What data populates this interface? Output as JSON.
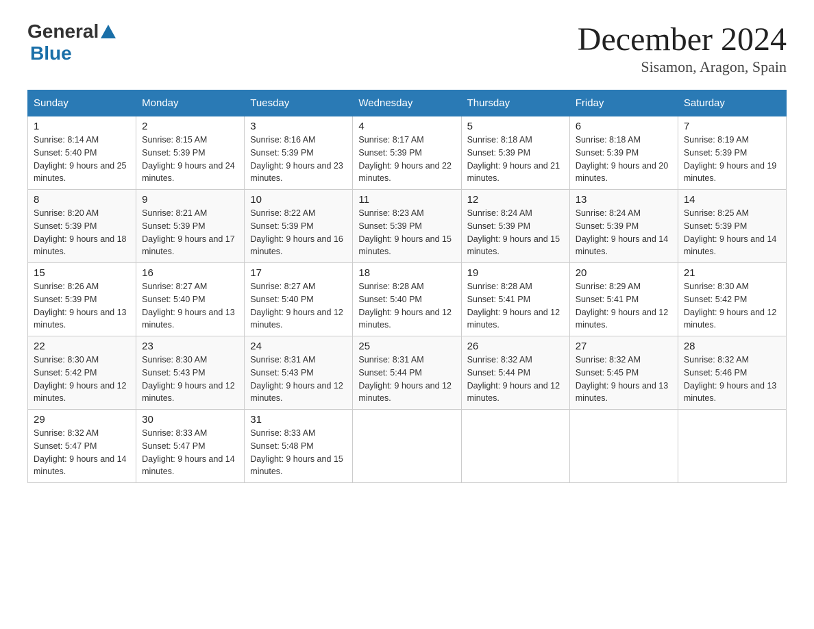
{
  "header": {
    "title": "December 2024",
    "location": "Sisamon, Aragon, Spain",
    "logo_general": "General",
    "logo_blue": "Blue"
  },
  "days_of_week": [
    "Sunday",
    "Monday",
    "Tuesday",
    "Wednesday",
    "Thursday",
    "Friday",
    "Saturday"
  ],
  "weeks": [
    [
      {
        "day": "1",
        "sunrise": "8:14 AM",
        "sunset": "5:40 PM",
        "daylight": "9 hours and 25 minutes."
      },
      {
        "day": "2",
        "sunrise": "8:15 AM",
        "sunset": "5:39 PM",
        "daylight": "9 hours and 24 minutes."
      },
      {
        "day": "3",
        "sunrise": "8:16 AM",
        "sunset": "5:39 PM",
        "daylight": "9 hours and 23 minutes."
      },
      {
        "day": "4",
        "sunrise": "8:17 AM",
        "sunset": "5:39 PM",
        "daylight": "9 hours and 22 minutes."
      },
      {
        "day": "5",
        "sunrise": "8:18 AM",
        "sunset": "5:39 PM",
        "daylight": "9 hours and 21 minutes."
      },
      {
        "day": "6",
        "sunrise": "8:18 AM",
        "sunset": "5:39 PM",
        "daylight": "9 hours and 20 minutes."
      },
      {
        "day": "7",
        "sunrise": "8:19 AM",
        "sunset": "5:39 PM",
        "daylight": "9 hours and 19 minutes."
      }
    ],
    [
      {
        "day": "8",
        "sunrise": "8:20 AM",
        "sunset": "5:39 PM",
        "daylight": "9 hours and 18 minutes."
      },
      {
        "day": "9",
        "sunrise": "8:21 AM",
        "sunset": "5:39 PM",
        "daylight": "9 hours and 17 minutes."
      },
      {
        "day": "10",
        "sunrise": "8:22 AM",
        "sunset": "5:39 PM",
        "daylight": "9 hours and 16 minutes."
      },
      {
        "day": "11",
        "sunrise": "8:23 AM",
        "sunset": "5:39 PM",
        "daylight": "9 hours and 15 minutes."
      },
      {
        "day": "12",
        "sunrise": "8:24 AM",
        "sunset": "5:39 PM",
        "daylight": "9 hours and 15 minutes."
      },
      {
        "day": "13",
        "sunrise": "8:24 AM",
        "sunset": "5:39 PM",
        "daylight": "9 hours and 14 minutes."
      },
      {
        "day": "14",
        "sunrise": "8:25 AM",
        "sunset": "5:39 PM",
        "daylight": "9 hours and 14 minutes."
      }
    ],
    [
      {
        "day": "15",
        "sunrise": "8:26 AM",
        "sunset": "5:39 PM",
        "daylight": "9 hours and 13 minutes."
      },
      {
        "day": "16",
        "sunrise": "8:27 AM",
        "sunset": "5:40 PM",
        "daylight": "9 hours and 13 minutes."
      },
      {
        "day": "17",
        "sunrise": "8:27 AM",
        "sunset": "5:40 PM",
        "daylight": "9 hours and 12 minutes."
      },
      {
        "day": "18",
        "sunrise": "8:28 AM",
        "sunset": "5:40 PM",
        "daylight": "9 hours and 12 minutes."
      },
      {
        "day": "19",
        "sunrise": "8:28 AM",
        "sunset": "5:41 PM",
        "daylight": "9 hours and 12 minutes."
      },
      {
        "day": "20",
        "sunrise": "8:29 AM",
        "sunset": "5:41 PM",
        "daylight": "9 hours and 12 minutes."
      },
      {
        "day": "21",
        "sunrise": "8:30 AM",
        "sunset": "5:42 PM",
        "daylight": "9 hours and 12 minutes."
      }
    ],
    [
      {
        "day": "22",
        "sunrise": "8:30 AM",
        "sunset": "5:42 PM",
        "daylight": "9 hours and 12 minutes."
      },
      {
        "day": "23",
        "sunrise": "8:30 AM",
        "sunset": "5:43 PM",
        "daylight": "9 hours and 12 minutes."
      },
      {
        "day": "24",
        "sunrise": "8:31 AM",
        "sunset": "5:43 PM",
        "daylight": "9 hours and 12 minutes."
      },
      {
        "day": "25",
        "sunrise": "8:31 AM",
        "sunset": "5:44 PM",
        "daylight": "9 hours and 12 minutes."
      },
      {
        "day": "26",
        "sunrise": "8:32 AM",
        "sunset": "5:44 PM",
        "daylight": "9 hours and 12 minutes."
      },
      {
        "day": "27",
        "sunrise": "8:32 AM",
        "sunset": "5:45 PM",
        "daylight": "9 hours and 13 minutes."
      },
      {
        "day": "28",
        "sunrise": "8:32 AM",
        "sunset": "5:46 PM",
        "daylight": "9 hours and 13 minutes."
      }
    ],
    [
      {
        "day": "29",
        "sunrise": "8:32 AM",
        "sunset": "5:47 PM",
        "daylight": "9 hours and 14 minutes."
      },
      {
        "day": "30",
        "sunrise": "8:33 AM",
        "sunset": "5:47 PM",
        "daylight": "9 hours and 14 minutes."
      },
      {
        "day": "31",
        "sunrise": "8:33 AM",
        "sunset": "5:48 PM",
        "daylight": "9 hours and 15 minutes."
      },
      null,
      null,
      null,
      null
    ]
  ]
}
